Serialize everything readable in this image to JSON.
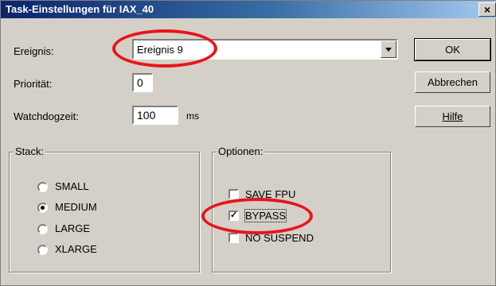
{
  "window": {
    "title": "Task-Einstellungen für IAX_40",
    "close_label": "×"
  },
  "fields": {
    "ereignis": {
      "label": "Ereignis:",
      "value": "Ereignis 9"
    },
    "prioritaet": {
      "label": "Priorität:",
      "value": "0"
    },
    "watchdog": {
      "label": "Watchdogzeit:",
      "value": "100",
      "unit": "ms"
    }
  },
  "buttons": {
    "ok": "OK",
    "cancel": "Abbrechen",
    "help": "Hilfe"
  },
  "stack": {
    "legend": "Stack:",
    "options": [
      {
        "label": "SMALL",
        "selected": false
      },
      {
        "label": "MEDIUM",
        "selected": true
      },
      {
        "label": "LARGE",
        "selected": false
      },
      {
        "label": "XLARGE",
        "selected": false
      }
    ]
  },
  "optionen": {
    "legend": "Optionen:",
    "options": [
      {
        "label": "SAVE FPU",
        "checked": false
      },
      {
        "label": "BYPASS",
        "checked": true
      },
      {
        "label": "NO SUSPEND",
        "checked": false
      }
    ]
  },
  "colors": {
    "titlebar": "#0a246a",
    "face": "#d4d0c8",
    "highlight": "#e8141c"
  }
}
